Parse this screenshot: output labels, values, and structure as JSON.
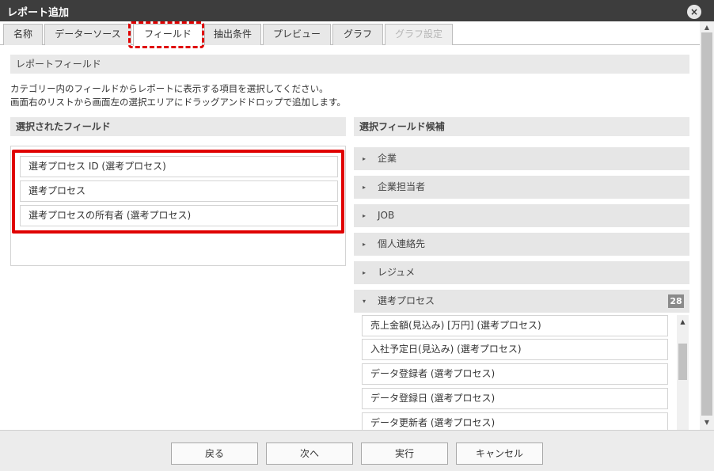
{
  "window": {
    "title": "レポート追加",
    "close_icon": "×"
  },
  "tabs": [
    {
      "label": "名称"
    },
    {
      "label": "データーソース"
    },
    {
      "label": "フィールド"
    },
    {
      "label": "抽出条件"
    },
    {
      "label": "プレビュー"
    },
    {
      "label": "グラフ"
    },
    {
      "label": "グラフ設定"
    }
  ],
  "report_field": {
    "heading": "レポートフィールド",
    "desc_line1": "カテゴリー内のフィールドからレポートに表示する項目を選択してください。",
    "desc_line2": "画面右のリストから画面左の選択エリアにドラッグアンドドロップで追加します。"
  },
  "selected": {
    "heading": "選択されたフィールド",
    "items": [
      {
        "label": "選考プロセス ID (選考プロセス)"
      },
      {
        "label": "選考プロセス"
      },
      {
        "label": "選考プロセスの所有者 (選考プロセス)"
      }
    ]
  },
  "candidates": {
    "heading": "選択フィールド候補",
    "categories": [
      {
        "label": "企業",
        "arrow": "▸"
      },
      {
        "label": "企業担当者",
        "arrow": "▸"
      },
      {
        "label": "JOB",
        "arrow": "▸"
      },
      {
        "label": "個人連絡先",
        "arrow": "▸"
      },
      {
        "label": "レジュメ",
        "arrow": "▸"
      },
      {
        "label": "選考プロセス",
        "arrow": "▾",
        "badge": "28"
      }
    ],
    "fields": [
      {
        "label": "売上金額(見込み) [万円] (選考プロセス)"
      },
      {
        "label": "入社予定日(見込み) (選考プロセス)"
      },
      {
        "label": "データ登録者 (選考プロセス)"
      },
      {
        "label": "データ登録日 (選考プロセス)"
      },
      {
        "label": "データ更新者 (選考プロセス)"
      }
    ]
  },
  "footer": {
    "back": "戻る",
    "next": "次へ",
    "run": "実行",
    "cancel": "キャンセル"
  }
}
